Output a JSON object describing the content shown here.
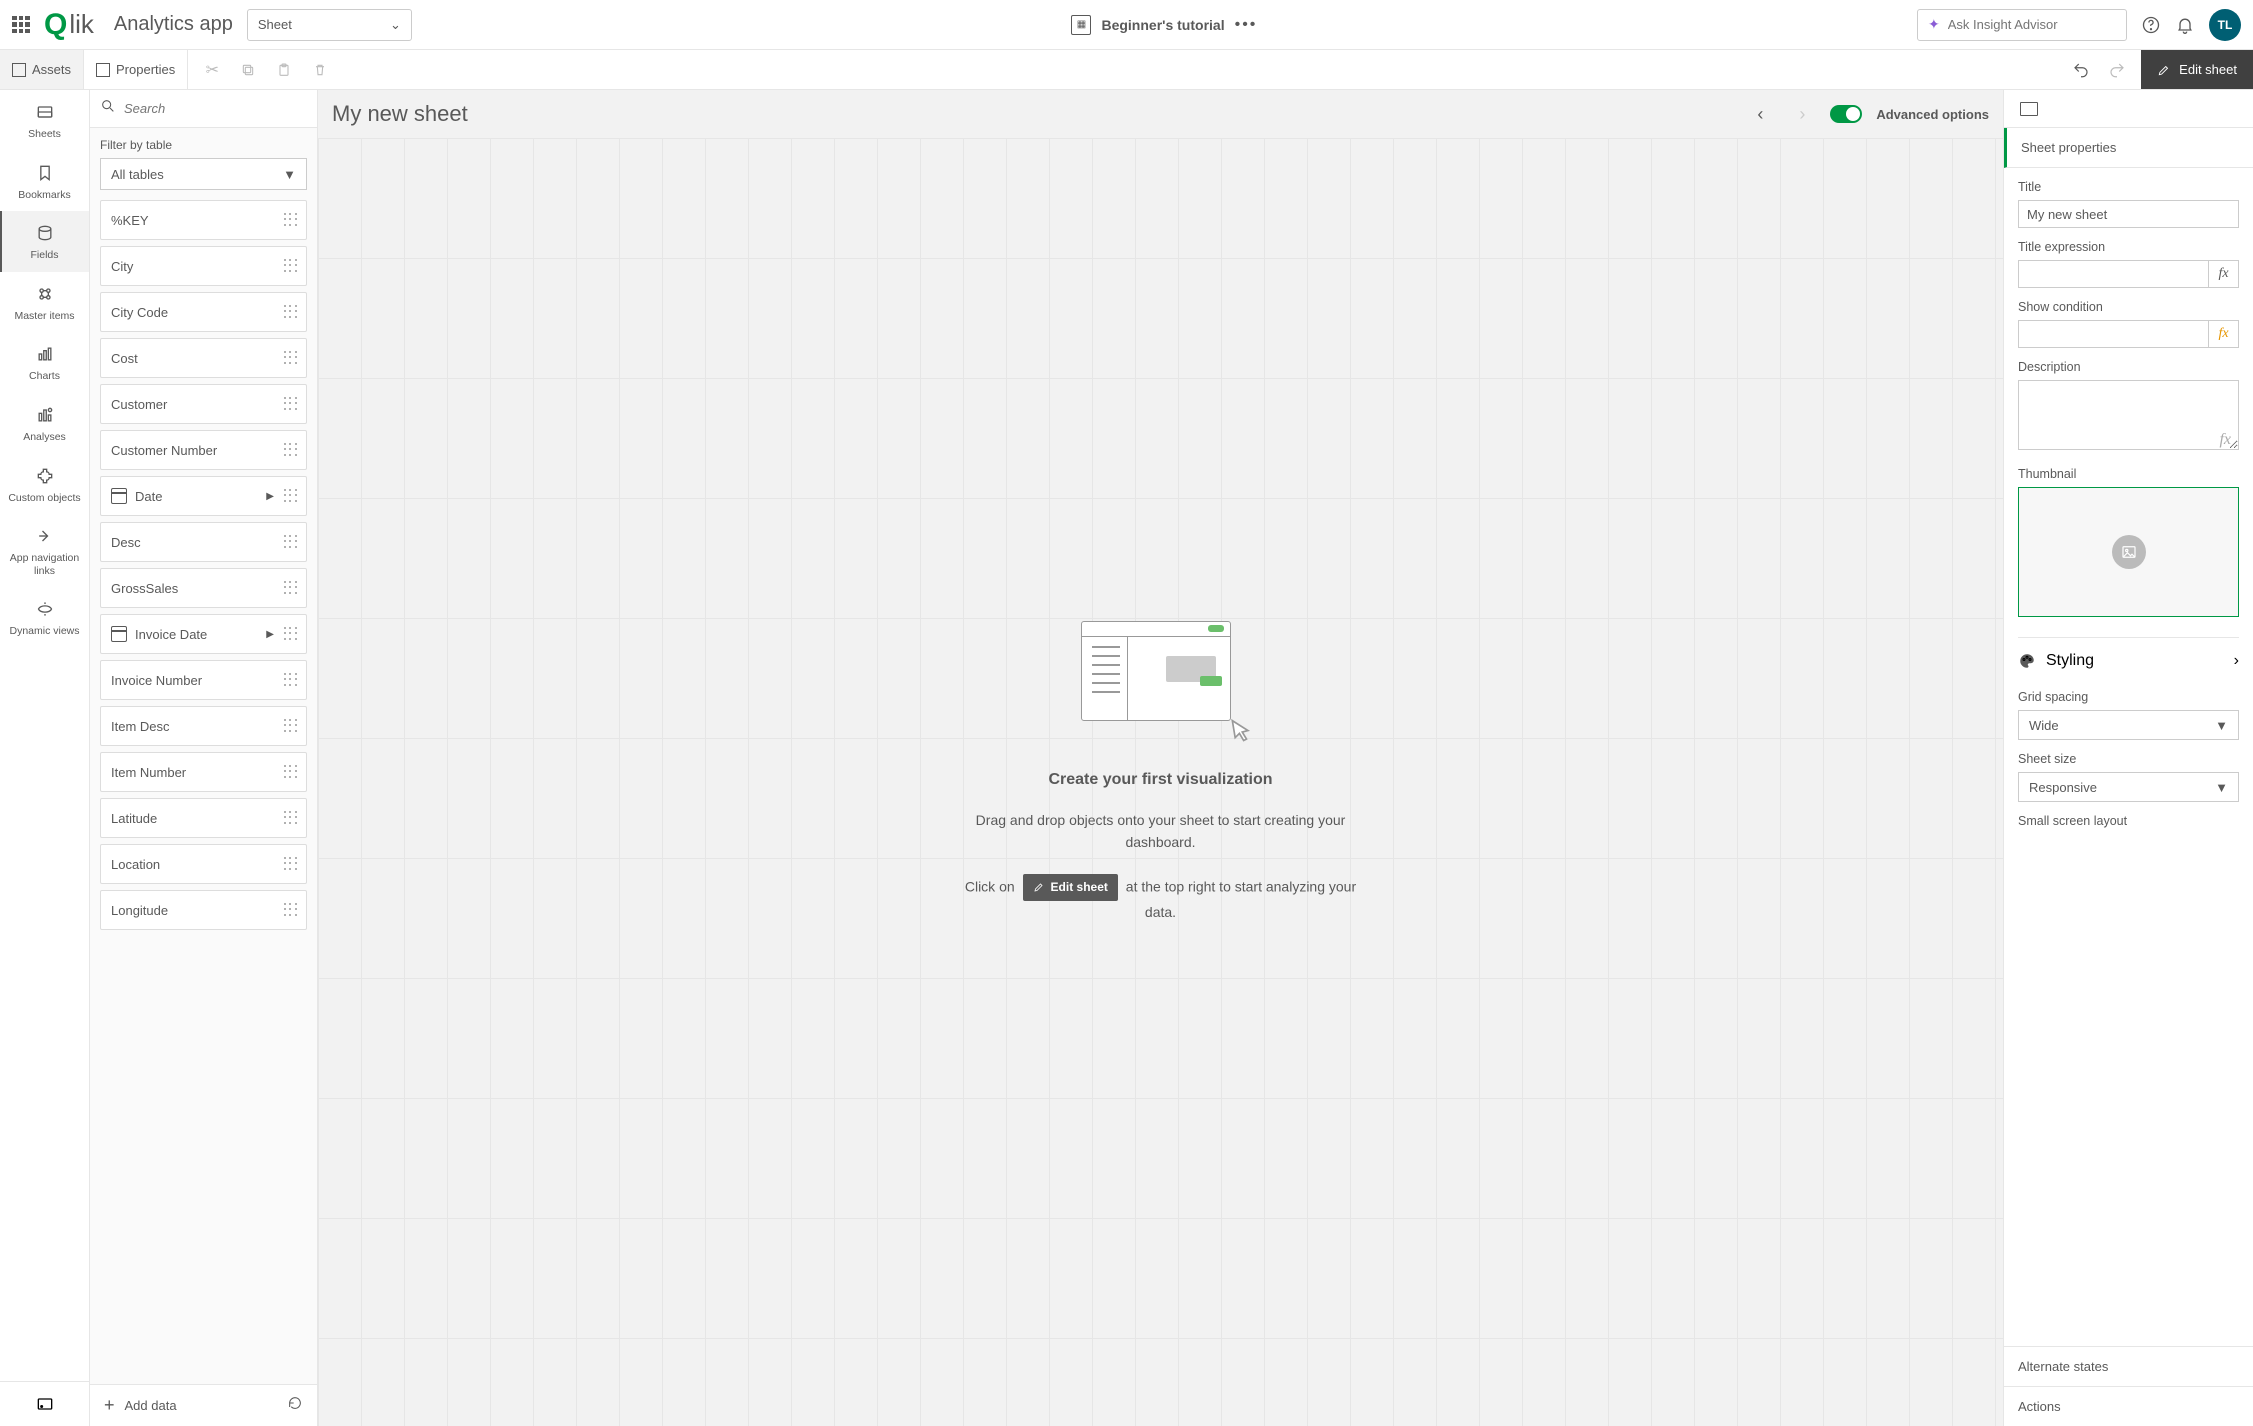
{
  "header": {
    "brand": "Qlik",
    "app_name": "Analytics app",
    "sheet_dd": "Sheet",
    "tutorial": "Beginner's tutorial",
    "insight_placeholder": "Ask Insight Advisor",
    "avatar": "TL"
  },
  "toolbar2": {
    "assets": "Assets",
    "properties": "Properties",
    "edit_sheet": "Edit sheet"
  },
  "rail": {
    "sheets": "Sheets",
    "bookmarks": "Bookmarks",
    "fields": "Fields",
    "master_items": "Master items",
    "charts": "Charts",
    "analyses": "Analyses",
    "custom_objects": "Custom objects",
    "app_nav": "App navigation links",
    "dynamic_views": "Dynamic views"
  },
  "fields_panel": {
    "search_placeholder": "Search",
    "filter_label": "Filter by table",
    "table_dd": "All tables",
    "add_data": "Add data",
    "items": [
      {
        "label": "%KEY",
        "date": false
      },
      {
        "label": "City",
        "date": false
      },
      {
        "label": "City Code",
        "date": false
      },
      {
        "label": "Cost",
        "date": false
      },
      {
        "label": "Customer",
        "date": false
      },
      {
        "label": "Customer Number",
        "date": false
      },
      {
        "label": "Date",
        "date": true
      },
      {
        "label": "Desc",
        "date": false
      },
      {
        "label": "GrossSales",
        "date": false
      },
      {
        "label": "Invoice Date",
        "date": true
      },
      {
        "label": "Invoice Number",
        "date": false
      },
      {
        "label": "Item Desc",
        "date": false
      },
      {
        "label": "Item Number",
        "date": false
      },
      {
        "label": "Latitude",
        "date": false
      },
      {
        "label": "Location",
        "date": false
      },
      {
        "label": "Longitude",
        "date": false
      }
    ]
  },
  "canvas": {
    "title": "My new sheet",
    "adv_label": "Advanced options",
    "placeholder_title": "Create your first visualization",
    "placeholder_line1": "Drag and drop objects onto your sheet to start creating your dashboard.",
    "placeholder_click_on": "Click on",
    "placeholder_edit_sheet": "Edit sheet",
    "placeholder_after": "at the top right to start analyzing your data."
  },
  "properties": {
    "section_title": "Sheet properties",
    "title_label": "Title",
    "title_value": "My new sheet",
    "title_expr_label": "Title expression",
    "show_cond_label": "Show condition",
    "description_label": "Description",
    "thumbnail_label": "Thumbnail",
    "styling_label": "Styling",
    "grid_spacing_label": "Grid spacing",
    "grid_spacing_value": "Wide",
    "sheet_size_label": "Sheet size",
    "sheet_size_value": "Responsive",
    "small_screen_label": "Small screen layout",
    "alternate_states": "Alternate states",
    "actions": "Actions"
  }
}
